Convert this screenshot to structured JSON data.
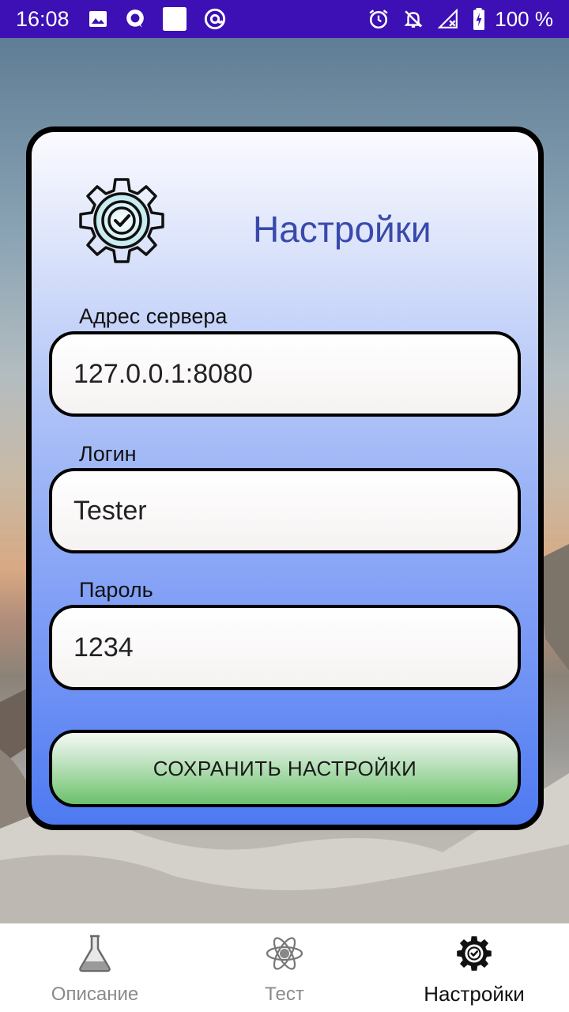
{
  "status_bar": {
    "time": "16:08",
    "battery": "100 %",
    "left_icons": [
      "image-icon",
      "messenger-icon",
      "square-icon",
      "at-icon"
    ],
    "right_icons": [
      "alarm-icon",
      "notifications-off-icon",
      "signal-icon",
      "battery-icon"
    ]
  },
  "card": {
    "title": "Настройки",
    "icon": "gear-check-icon",
    "server": {
      "label": "Адрес сервера",
      "value": "127.0.0.1:8080"
    },
    "login": {
      "label": "Логин",
      "value": "Tester"
    },
    "password": {
      "label": "Пароль",
      "value": "1234"
    },
    "save_label": "СОХРАНИТЬ НАСТРОЙКИ"
  },
  "nav": {
    "items": [
      {
        "label": "Описание",
        "icon": "flask-icon",
        "active": false
      },
      {
        "label": "Тест",
        "icon": "atom-icon",
        "active": false
      },
      {
        "label": "Настройки",
        "icon": "gear-check-icon",
        "active": true
      }
    ]
  },
  "colors": {
    "status_bar": "#3c10b4",
    "title": "#3949ab",
    "card_gradient_bottom": "#4e7af1",
    "button_green": "#6cc06d"
  }
}
